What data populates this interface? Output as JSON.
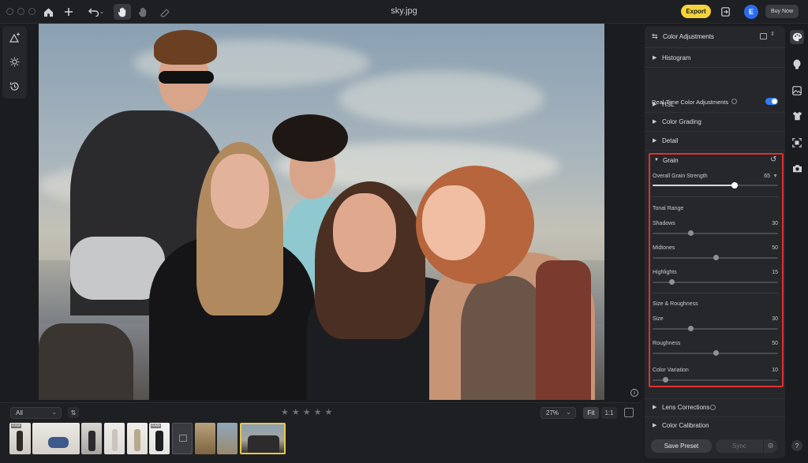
{
  "app": {
    "title": "sky.jpg"
  },
  "toolbar": {
    "export_label": "Export",
    "user_initial": "E",
    "buy_label": "Buy Now"
  },
  "filmstrip": {
    "filter_value": "All",
    "stars": [
      "★",
      "★",
      "★",
      "★",
      "★"
    ],
    "zoom_value": "27%",
    "fit_label": "Fit",
    "one_to_one_label": "1:1",
    "raw_tag": "RAW"
  },
  "panel": {
    "title": "Color Adjustments",
    "sections_top": [
      {
        "label": "Histogram"
      }
    ],
    "realtime_label": "Real-Time Color Adjustments",
    "realtime_on": true,
    "sections_mid": [
      {
        "label": "HSL"
      },
      {
        "label": "Color Grading"
      },
      {
        "label": "Detail"
      }
    ],
    "grain": {
      "label": "Grain",
      "overall": {
        "name": "Overall Grain Strength",
        "value": "65",
        "level": 0.65
      },
      "tonal_title": "Tonal Range",
      "tonal": [
        {
          "name": "Shadows",
          "value": "30",
          "level": 0.3
        },
        {
          "name": "Midtones",
          "value": "50",
          "level": 0.5
        },
        {
          "name": "Highlights",
          "value": "15",
          "level": 0.15
        }
      ],
      "size_title": "Size & Roughness",
      "size": [
        {
          "name": "Size",
          "value": "30",
          "level": 0.3
        },
        {
          "name": "Roughness",
          "value": "50",
          "level": 0.5
        },
        {
          "name": "Color Variation",
          "value": "10",
          "level": 0.1
        }
      ]
    },
    "sections_bottom": [
      {
        "label": "Lens Corrections",
        "info": true
      },
      {
        "label": "Color Calibration",
        "info": false
      }
    ],
    "save_preset_label": "Save Preset",
    "sync_label": "Sync"
  },
  "colors": {
    "accent": "#2f7cf6",
    "export": "#f4d43c",
    "highlight_box": "#e0302e"
  }
}
